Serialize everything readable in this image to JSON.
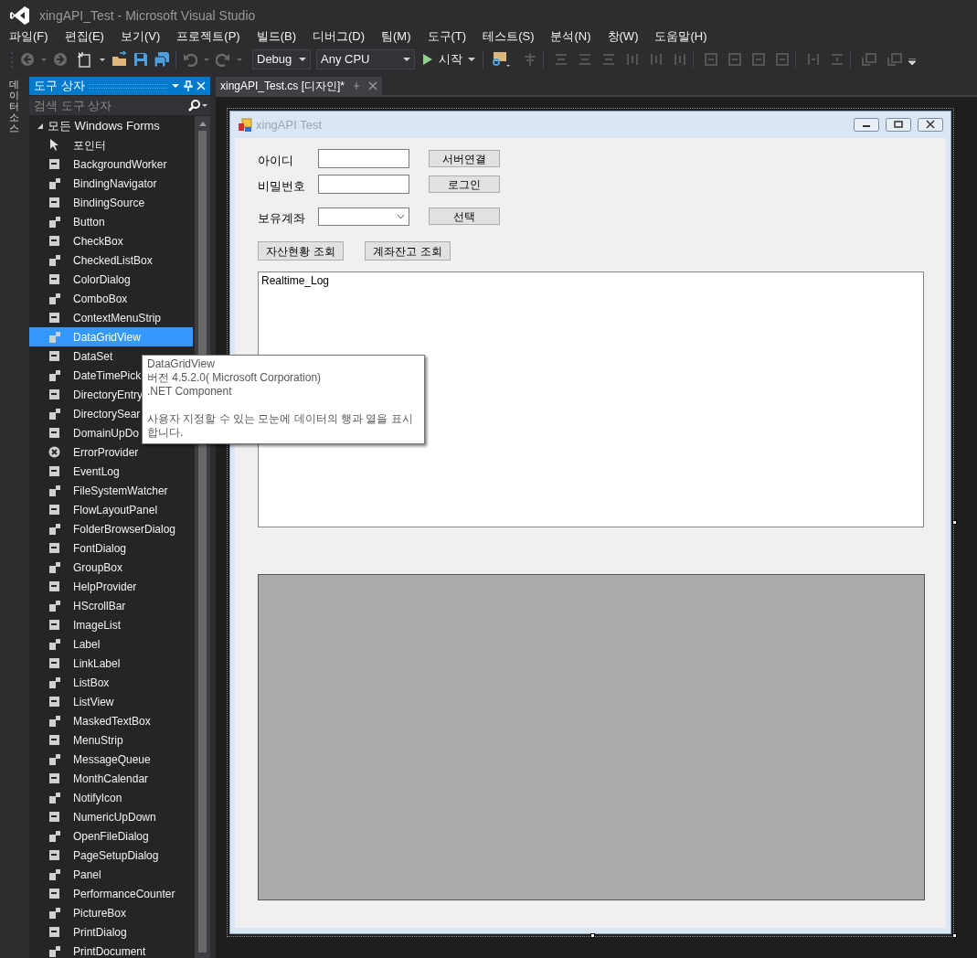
{
  "window": {
    "title": "xingAPI_Test - Microsoft Visual Studio"
  },
  "menu": [
    "파일(F)",
    "편집(E)",
    "보기(V)",
    "프로젝트(P)",
    "빌드(B)",
    "디버그(D)",
    "팀(M)",
    "도구(T)",
    "테스트(S)",
    "분석(N)",
    "창(W)",
    "도움말(H)"
  ],
  "toolbar": {
    "configuration": "Debug",
    "platform": "Any CPU",
    "start": "시작"
  },
  "side_tab": {
    "label": "데이터 소스"
  },
  "toolbox": {
    "title": "도구 상자",
    "search": {
      "placeholder": "검색 도구 상자"
    },
    "category": {
      "label": "모든 Windows Forms",
      "expanded": true
    },
    "items": [
      {
        "label": "포인터",
        "selected": false
      },
      {
        "label": "BackgroundWorker",
        "selected": false
      },
      {
        "label": "BindingNavigator",
        "selected": false
      },
      {
        "label": "BindingSource",
        "selected": false
      },
      {
        "label": "Button",
        "selected": false
      },
      {
        "label": "CheckBox",
        "selected": false
      },
      {
        "label": "CheckedListBox",
        "selected": false
      },
      {
        "label": "ColorDialog",
        "selected": false
      },
      {
        "label": "ComboBox",
        "selected": false
      },
      {
        "label": "ContextMenuStrip",
        "selected": false
      },
      {
        "label": "DataGridView",
        "selected": true
      },
      {
        "label": "DataSet",
        "selected": false
      },
      {
        "label": "DateTimePick",
        "selected": false
      },
      {
        "label": "DirectoryEntry",
        "selected": false
      },
      {
        "label": "DirectorySear",
        "selected": false
      },
      {
        "label": "DomainUpDo",
        "selected": false
      },
      {
        "label": "ErrorProvider",
        "selected": false
      },
      {
        "label": "EventLog",
        "selected": false
      },
      {
        "label": "FileSystemWatcher",
        "selected": false
      },
      {
        "label": "FlowLayoutPanel",
        "selected": false
      },
      {
        "label": "FolderBrowserDialog",
        "selected": false
      },
      {
        "label": "FontDialog",
        "selected": false
      },
      {
        "label": "GroupBox",
        "selected": false
      },
      {
        "label": "HelpProvider",
        "selected": false
      },
      {
        "label": "HScrollBar",
        "selected": false
      },
      {
        "label": "ImageList",
        "selected": false
      },
      {
        "label": "Label",
        "selected": false
      },
      {
        "label": "LinkLabel",
        "selected": false
      },
      {
        "label": "ListBox",
        "selected": false
      },
      {
        "label": "ListView",
        "selected": false
      },
      {
        "label": "MaskedTextBox",
        "selected": false
      },
      {
        "label": "MenuStrip",
        "selected": false
      },
      {
        "label": "MessageQueue",
        "selected": false
      },
      {
        "label": "MonthCalendar",
        "selected": false
      },
      {
        "label": "NotifyIcon",
        "selected": false
      },
      {
        "label": "NumericUpDown",
        "selected": false
      },
      {
        "label": "OpenFileDialog",
        "selected": false
      },
      {
        "label": "PageSetupDialog",
        "selected": false
      },
      {
        "label": "Panel",
        "selected": false
      },
      {
        "label": "PerformanceCounter",
        "selected": false
      },
      {
        "label": "PictureBox",
        "selected": false
      },
      {
        "label": "PrintDialog",
        "selected": false
      },
      {
        "label": "PrintDocument",
        "selected": false
      }
    ]
  },
  "tooltip": {
    "lines": [
      "DataGridView",
      "버전 4.5.2.0( Microsoft Corporation)",
      ".NET Component"
    ],
    "description": "사용자 지정할 수 있는 모눈에 데이터의 행과 열을 표시 합니다."
  },
  "document_tab": {
    "label": "xingAPI_Test.cs [디자인]*",
    "selected": true
  },
  "form": {
    "title": "xingAPI Test",
    "rows": [
      {
        "label": "아이디",
        "kind": "text",
        "button": "서버연결"
      },
      {
        "label": "비밀번호",
        "kind": "text",
        "button": "로그인"
      },
      {
        "label": "보유계좌",
        "kind": "combo",
        "button": "선택"
      }
    ],
    "buttons": [
      "자산현황 조회",
      "계좌잔고 조회"
    ],
    "log": {
      "value": "Realtime_Log"
    }
  }
}
